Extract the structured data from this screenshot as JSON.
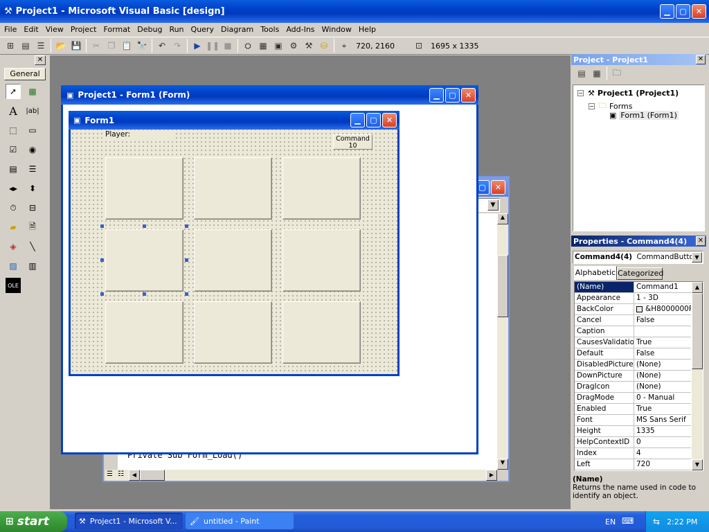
{
  "window": {
    "title": "Project1 - Microsoft Visual Basic [design]"
  },
  "menu": [
    "File",
    "Edit",
    "View",
    "Project",
    "Format",
    "Debug",
    "Run",
    "Query",
    "Diagram",
    "Tools",
    "Add-Ins",
    "Window",
    "Help"
  ],
  "toolbar": {
    "position_readout": "720, 2160",
    "size_readout": "1695 x 1335"
  },
  "toolbox": {
    "tab_label": "General"
  },
  "form_designer": {
    "title": "Project1 - Form1 (Form)"
  },
  "form1": {
    "title": "Form1",
    "player_label": "Player:",
    "command10_caption_line1": "Command",
    "command10_caption_line2": "10"
  },
  "code_window": {
    "visible_code": "Private Sub Form_Load()"
  },
  "project_explorer": {
    "title": "Project - Project1",
    "root": "Project1 (Project1)",
    "folder": "Forms",
    "item": "Form1 (Form1)"
  },
  "properties": {
    "title": "Properties - Command4(4)",
    "object_name": "Command4(4)",
    "object_type": "CommandButton",
    "tabs": [
      "Alphabetic",
      "Categorized"
    ],
    "rows": [
      {
        "k": "(Name)",
        "v": "Command1"
      },
      {
        "k": "Appearance",
        "v": "1 - 3D"
      },
      {
        "k": "BackColor",
        "v": "&H8000000F"
      },
      {
        "k": "Cancel",
        "v": "False"
      },
      {
        "k": "Caption",
        "v": ""
      },
      {
        "k": "CausesValidation",
        "v": "True"
      },
      {
        "k": "Default",
        "v": "False"
      },
      {
        "k": "DisabledPicture",
        "v": "(None)"
      },
      {
        "k": "DownPicture",
        "v": "(None)"
      },
      {
        "k": "DragIcon",
        "v": "(None)"
      },
      {
        "k": "DragMode",
        "v": "0 - Manual"
      },
      {
        "k": "Enabled",
        "v": "True"
      },
      {
        "k": "Font",
        "v": "MS Sans Serif"
      },
      {
        "k": "Height",
        "v": "1335"
      },
      {
        "k": "HelpContextID",
        "v": "0"
      },
      {
        "k": "Index",
        "v": "4"
      },
      {
        "k": "Left",
        "v": "720"
      }
    ],
    "desc_title": "(Name)",
    "desc_text": "Returns the name used in code to identify an object."
  },
  "taskbar": {
    "start": "start",
    "items": [
      "Project1 - Microsoft V...",
      "untitled - Paint"
    ],
    "lang": "EN",
    "clock": "2:22 PM"
  },
  "colors": {
    "xp_blue": "#0040c8",
    "mdi_bg": "#808080",
    "form_bg": "#ece9d8",
    "selection": "#0a246a"
  }
}
